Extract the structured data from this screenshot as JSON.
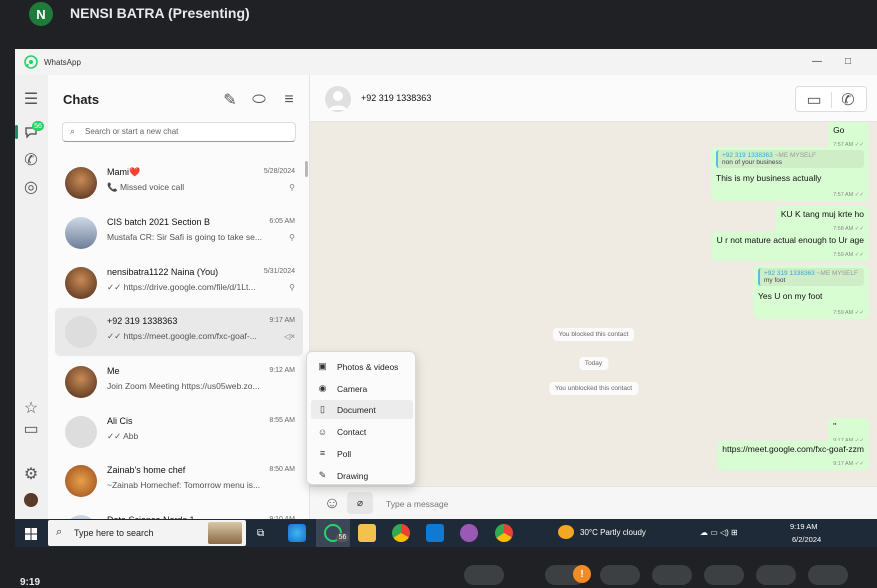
{
  "meet": {
    "avatar_letter": "N",
    "presenter": "NENSI BATRA (Presenting)",
    "time_partial": "9:19",
    "notify_badge": "!"
  },
  "window": {
    "title": "WhatsApp",
    "minimize": "—",
    "maximize": "□"
  },
  "rail": {
    "chats_badge": "56"
  },
  "chatlist": {
    "title": "Chats",
    "search_placeholder": "Search or start a new chat",
    "items": [
      {
        "name": "Mami❤️",
        "preview": "📞 Missed voice call",
        "time": "5/28/2024",
        "icon": "pin-icon",
        "avatar": "photo"
      },
      {
        "name": "CIS batch 2021 Section B",
        "preview": "Mustafa CR: Sir Safi is going to take se...",
        "time": "6:05 AM",
        "icon": "pin-icon",
        "avatar": "group"
      },
      {
        "name": "nensibatra1122 Naina (You)",
        "preview": "✓✓ https://drive.google.com/file/d/1Lt...",
        "time": "5/31/2024",
        "icon": "pin-icon",
        "avatar": "photo"
      },
      {
        "name": "+92 319 1338363",
        "preview": "✓✓ https://meet.google.com/fxc-goaf-...",
        "time": "9:17 AM",
        "icon": "mute-icon",
        "avatar": "default"
      },
      {
        "name": "Me",
        "preview": "Join Zoom Meeting https://us05web.zo...",
        "time": "9:12 AM",
        "icon": "",
        "avatar": "photo"
      },
      {
        "name": "Ali Cis",
        "preview": "✓✓ Abb",
        "time": "8:55 AM",
        "icon": "",
        "avatar": "default"
      },
      {
        "name": "Zainab's home chef",
        "preview": "~Zainab Homechef: Tomorrow menu is...",
        "time": "8:50 AM",
        "icon": "",
        "avatar": "food"
      },
      {
        "name": "Data Science Nerds 1",
        "preview": "",
        "time": "9:10 AM",
        "icon": "",
        "avatar": "group"
      }
    ]
  },
  "conversation": {
    "contact": "+92 319 1338363",
    "messages": [
      {
        "type": "out",
        "text": "Go",
        "time": "7:57 AM ✓✓"
      },
      {
        "type": "out-quote",
        "quote_author": "+92 319 1338363",
        "quote_tag": "~ME MYSELF",
        "quote_text": "non of your business",
        "text": "This is my business actually",
        "time": "7:57 AM ✓✓"
      },
      {
        "type": "out",
        "text": "KU K tang muj krte ho",
        "time": "7:58 AM ✓✓"
      },
      {
        "type": "out",
        "text": "U r not mature actual enough to Ur age",
        "time": "7:59 AM ✓✓"
      },
      {
        "type": "out-quote",
        "quote_author": "+92 319 1338363",
        "quote_tag": "~ME MYSELF",
        "quote_text": "my foot",
        "text": "Yes U on my foot",
        "time": "7:59 AM ✓✓"
      },
      {
        "type": "system",
        "text": "You blocked this contact"
      },
      {
        "type": "system",
        "text": "Today"
      },
      {
        "type": "system",
        "text": "You unblocked this contact"
      },
      {
        "type": "out",
        "text": "''",
        "time": "9:17 AM ✓✓"
      },
      {
        "type": "out",
        "text": "https://meet.google.com/fxc-goaf-zzm",
        "time": "9:17 AM ✓✓"
      }
    ],
    "input_placeholder": "Type a message"
  },
  "attach_menu": {
    "items": [
      {
        "label": "Photos & videos",
        "icon": "photo-icon",
        "glyph": "▣"
      },
      {
        "label": "Camera",
        "icon": "camera-icon",
        "glyph": "◉"
      },
      {
        "label": "Document",
        "icon": "document-icon",
        "glyph": "▯"
      },
      {
        "label": "Contact",
        "icon": "contact-icon",
        "glyph": "☺"
      },
      {
        "label": "Poll",
        "icon": "poll-icon",
        "glyph": "≡"
      },
      {
        "label": "Drawing",
        "icon": "drawing-icon",
        "glyph": "✎"
      }
    ],
    "highlighted": "Document"
  },
  "taskbar": {
    "search_placeholder": "Type here to search",
    "whatsapp_badge": "56",
    "weather": "30°C Partly cloudy",
    "time": "9:19 AM",
    "date": "6/2/2024"
  },
  "colors": {
    "accent": "#1a8d5f",
    "bubble_out": "#d9fdd3",
    "taskbar": "#1f2a38",
    "meet_bg": "#202124"
  }
}
